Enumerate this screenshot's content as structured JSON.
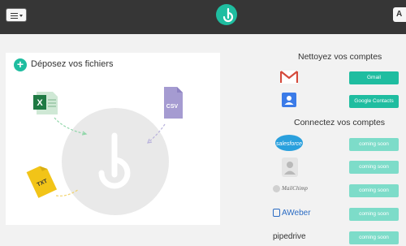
{
  "header": {
    "right_button_label": "A"
  },
  "dropzone": {
    "title": "Déposez vos fichiers",
    "file_types": [
      "CSV",
      "TXT"
    ]
  },
  "clean": {
    "title": "Nettoyez vos comptes",
    "items": [
      {
        "brand": "Gmail",
        "button": "Gmail"
      },
      {
        "brand": "Google Contacts",
        "button": "Google Contacts"
      }
    ]
  },
  "connect": {
    "title": "Connectez vos comptes",
    "items": [
      {
        "brand": "salesforce",
        "button": "coming soon"
      },
      {
        "brand": "contacts",
        "button": "coming soon"
      },
      {
        "brand": "MailChimp",
        "button": "coming soon"
      },
      {
        "brand": "AWeber",
        "button": "coming soon"
      },
      {
        "brand": "pipedrive",
        "button": "coming soon"
      }
    ]
  },
  "colors": {
    "topbar": "#363636",
    "accent": "#1fbda0",
    "accent_light": "#7ddcc9",
    "page_bg": "#f2f2f2"
  }
}
